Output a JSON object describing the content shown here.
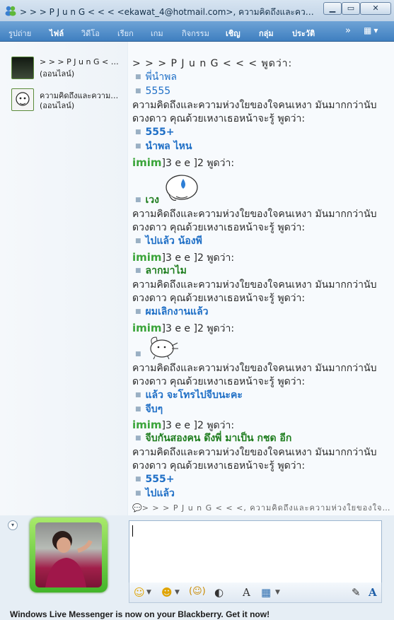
{
  "window": {
    "title": "> > >  P J u n G  < < < <ekawat_4@hotmail.com>, ความคิดถึงและความห่...",
    "minimize": "▁",
    "maximize": "▭",
    "close": "✕"
  },
  "menu": {
    "items": [
      "รูปถ่าย",
      "ไฟล์",
      "วิดีโอ",
      "เรียก",
      "เกม",
      "กิจกรรม",
      "เชิญ",
      "กลุ่ม",
      "ประวัติ"
    ],
    "more": "»",
    "options": "▾"
  },
  "contacts": [
    {
      "name": "> > >  P J u n G  < < <",
      "status": "(ออนไลน์)"
    },
    {
      "name": "ความคิดถึงและความห่วงใย...",
      "status": "(ออนไลน์)"
    }
  ],
  "conversation": {
    "header1": "> > >  P J u n G  < < <  พูดว่า:",
    "m1": "พี่นำพล",
    "m2": "5555",
    "speaker_a_line1": "ความคิดถึงและความห่วงใยของใจคนเหงา มันมากกว่านับ",
    "speaker_a_line2": "ดวงดาว คุณด้วยเหงาเธอหน้าจะรู้ พูดว่า:",
    "m3": "555+",
    "m4": "นำพล  ไหน",
    "imim": "imim",
    "header2_rest": "]3 e e ]2 พูดว่า:",
    "m5": "เวง",
    "m6": "ไปแล้ว น้องพี",
    "m7": "ลากมาไม",
    "m8": "ผมเลิกงานแล้ว",
    "m9": "แล้ว  จะโทรไปจีบนะคะ",
    "m10": "จีบๆ",
    "m11": "จีบกันสองคน ดึงพี่ มาเป็น กชด อีก",
    "m12": "555+",
    "m13": "ไปแล้ว",
    "typing": "> > >  P J u n G  < < <, ความคิดถึงและความห่วงใยของใจคนเ..."
  },
  "bottom": {
    "ad": "Windows Live Messenger is now on your Blackberry. Get it now!",
    "expand": "▾"
  },
  "toolbar": {
    "emoticon": "☺",
    "wink": "☻",
    "nudge": "(☺)",
    "voice": "◐",
    "font": "A",
    "bg": "▦",
    "handwrite": "✎",
    "text_mode": "A",
    "dd": "▼"
  },
  "colors": {
    "menubar": "#4f8ccb",
    "blue_text": "#1f6fc6",
    "green_text": "#1e7d1e",
    "avatar_frame": "#5cc238"
  }
}
